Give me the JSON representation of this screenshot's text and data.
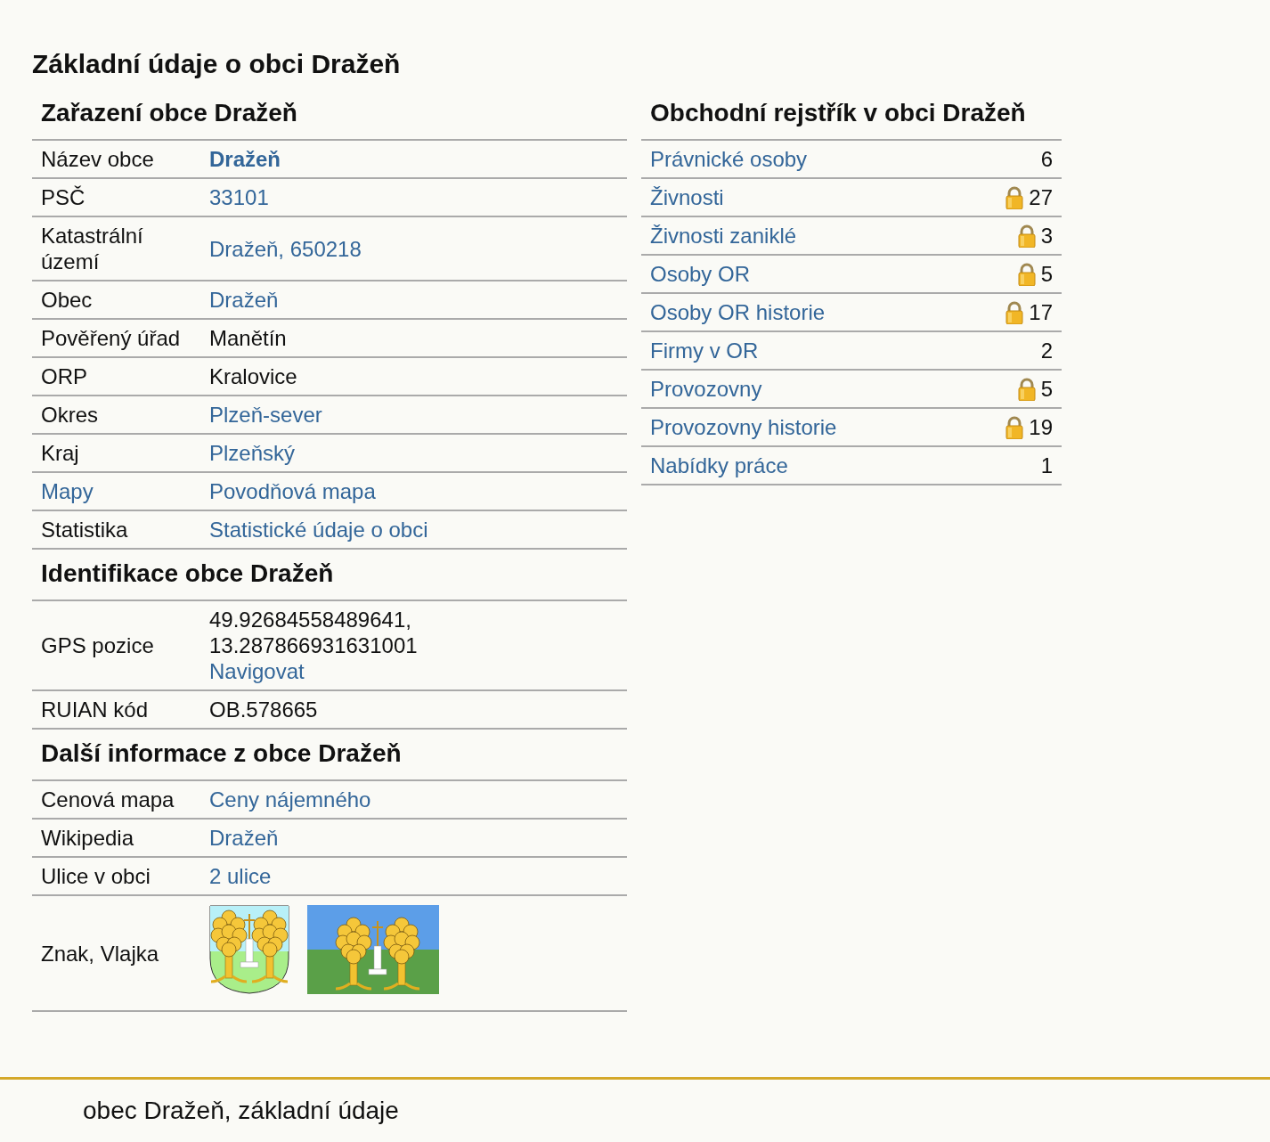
{
  "page_title": "Základní údaje o obci Dražeň",
  "left_sections": [
    {
      "title": "Zařazení obce Dražeň",
      "rows": [
        {
          "label": "Název obce",
          "label_link": false,
          "kind": "link",
          "value": "Dražeň",
          "bold": true
        },
        {
          "label": "PSČ",
          "label_link": false,
          "kind": "link",
          "value": "33101",
          "bold": false
        },
        {
          "label": "Katastrální území",
          "label_link": false,
          "kind": "link",
          "value": "Dražeň, 650218",
          "bold": false
        },
        {
          "label": "Obec",
          "label_link": false,
          "kind": "link",
          "value": "Dražeň",
          "bold": false
        },
        {
          "label": "Pověřený úřad",
          "label_link": false,
          "kind": "text",
          "value": "Manětín",
          "bold": false
        },
        {
          "label": "ORP",
          "label_link": false,
          "kind": "text",
          "value": "Kralovice",
          "bold": false
        },
        {
          "label": "Okres",
          "label_link": false,
          "kind": "link",
          "value": "Plzeň-sever",
          "bold": false
        },
        {
          "label": "Kraj",
          "label_link": false,
          "kind": "link",
          "value": "Plzeňský",
          "bold": false
        },
        {
          "label": "Mapy",
          "label_link": true,
          "kind": "link",
          "value": "Povodňová mapa",
          "bold": false
        },
        {
          "label": "Statistika",
          "label_link": false,
          "kind": "link",
          "value": "Statistické údaje o obci",
          "bold": false
        }
      ]
    },
    {
      "title": "Identifikace obce Dražeň",
      "rows": [
        {
          "label": "GPS pozice",
          "label_link": false,
          "kind": "gps",
          "lines": [
            "49.92684558489641,",
            "13.287866931631001"
          ],
          "value": "Navigovat"
        },
        {
          "label": "RUIAN kód",
          "label_link": false,
          "kind": "text",
          "value": "OB.578665",
          "bold": false
        }
      ]
    },
    {
      "title": "Další informace z obce Dražeň",
      "rows": [
        {
          "label": "Cenová mapa",
          "label_link": false,
          "kind": "link",
          "value": "Ceny nájemného",
          "bold": false
        },
        {
          "label": "Wikipedia",
          "label_link": false,
          "kind": "link",
          "value": "Dražeň",
          "bold": false
        },
        {
          "label": "Ulice v obci",
          "label_link": false,
          "kind": "link",
          "value": "2 ulice",
          "bold": false
        },
        {
          "label": "Znak, Vlajka",
          "label_link": false,
          "kind": "images",
          "images": [
            {
              "kind": "coat_of_arms"
            },
            {
              "kind": "flag"
            }
          ]
        }
      ]
    }
  ],
  "register": {
    "title": "Obchodní rejstřík v obci Dražeň",
    "rows": [
      {
        "label": "Právnické osoby",
        "count": "6",
        "locked": false
      },
      {
        "label": "Živnosti",
        "count": "27",
        "locked": true
      },
      {
        "label": "Živnosti zaniklé",
        "count": "3",
        "locked": true
      },
      {
        "label": "Osoby OR",
        "count": "5",
        "locked": true
      },
      {
        "label": "Osoby OR historie",
        "count": "17",
        "locked": true
      },
      {
        "label": "Firmy v OR",
        "count": "2",
        "locked": false
      },
      {
        "label": "Provozovny",
        "count": "5",
        "locked": true
      },
      {
        "label": "Provozovny historie",
        "count": "19",
        "locked": true
      },
      {
        "label": "Nabídky práce",
        "count": "1",
        "locked": false
      }
    ]
  },
  "footer": "obec Dražeň, základní údaje"
}
